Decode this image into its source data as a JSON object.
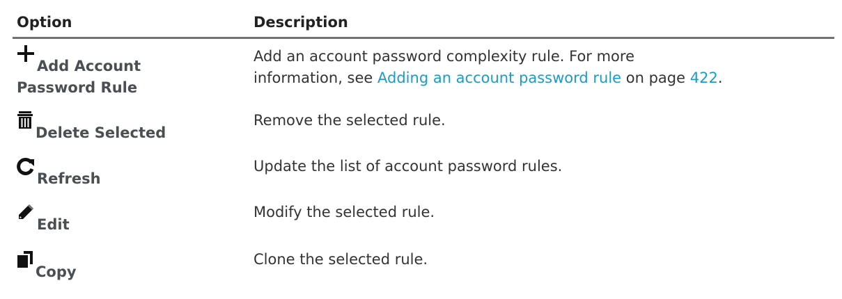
{
  "table": {
    "header": {
      "option": "Option",
      "description": "Description"
    },
    "rows": [
      {
        "icon": "plus-icon",
        "option_line1": "Add Account",
        "option_line2": "Password Rule",
        "desc_line1": "Add an account password complexity rule. For more",
        "desc_prefix": "information, see ",
        "desc_link": "Adding an account password rule",
        "desc_mid": " on page ",
        "desc_page": "422",
        "desc_suffix": "."
      },
      {
        "icon": "trash-icon",
        "option": "Delete Selected",
        "description": "Remove the selected rule."
      },
      {
        "icon": "refresh-icon",
        "option": "Refresh",
        "description": "Update the list of account password rules."
      },
      {
        "icon": "pencil-icon",
        "option": "Edit",
        "description": "Modify the selected rule."
      },
      {
        "icon": "copy-icon",
        "option": "Copy",
        "description": "Clone the selected rule."
      }
    ]
  },
  "colors": {
    "link": "#1b9bc9",
    "header_rule": "#6b7378",
    "option_text": "#4a4f54"
  }
}
